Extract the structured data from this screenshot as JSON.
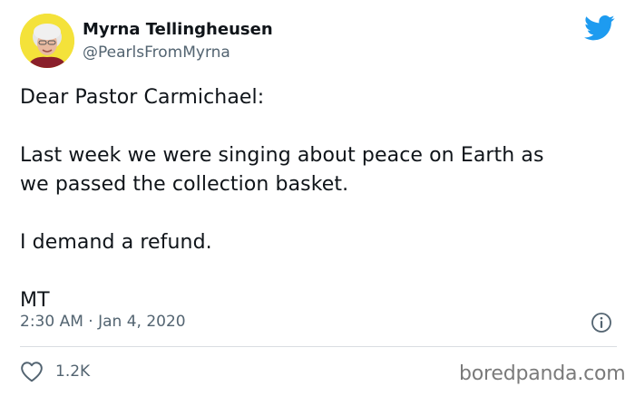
{
  "author": {
    "display_name": "Myrna Tellingheusen",
    "handle": "@PearlsFromMyrna",
    "avatar": "avatar-photo"
  },
  "tweet": {
    "lines": [
      "Dear Pastor Carmichael:",
      "Last week we were singing about peace on Earth as",
      "we passed the collection basket.",
      "I demand a refund.",
      "MT"
    ],
    "time": "2:30 AM",
    "separator": " · ",
    "date": "Jan 4, 2020",
    "likes": "1.2K"
  },
  "icons": {
    "brand": "twitter-bird-icon",
    "info": "info-icon",
    "like": "heart-icon"
  },
  "colors": {
    "brand_blue": "#1d9bf0",
    "muted_text": "#536471",
    "avatar_bg": "#f4e23a"
  },
  "watermark": "boredpanda.com"
}
